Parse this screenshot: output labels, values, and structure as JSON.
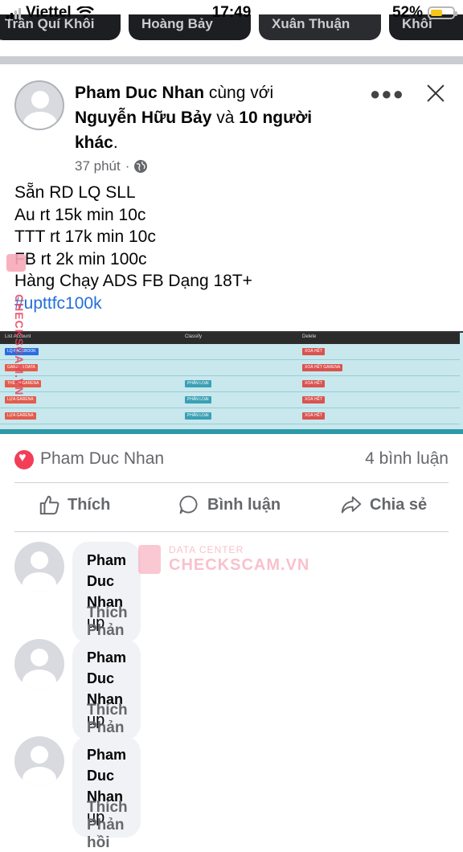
{
  "status_bar": {
    "carrier": "Viettel",
    "time": "17:49",
    "battery_percent": "52%",
    "battery_level": 0.52
  },
  "stories": [
    {
      "label": "Trần Quí Khôi"
    },
    {
      "label": "Hoàng Bảy"
    },
    {
      "label": "Xuân Thuận"
    },
    {
      "label": "Khôi"
    }
  ],
  "post": {
    "author": "Pham Duc Nhan",
    "with_text": "cùng với",
    "tagged_person": "Nguyễn Hữu Bảy",
    "and_text": "và",
    "others": "10 người khác",
    "end_dot": ".",
    "time": "37 phút",
    "dot": "·",
    "lines": [
      "Sẵn RD LQ SLL",
      "Au rt 15k min 10c",
      "TTT rt 17k min 10c",
      "FB rt 2k min 100c",
      "Hàng Chạy ADS FB Dạng 18T+"
    ],
    "hashtag": "#upttfc100k",
    "screenshot": {
      "headers": [
        "List Account",
        "Classify",
        "Delete"
      ],
      "rows": [
        {
          "account": "LQ FACEBOOK",
          "classify": "",
          "delete": "XOÁ HẾT"
        },
        {
          "account": "GARENA DATA",
          "classify": "",
          "delete": "XOÁ HẾT GARENA"
        },
        {
          "account": "THẺ 18 GARENA",
          "classify": "PHÂN LOẠI",
          "delete": "XOÁ HẾT"
        },
        {
          "account": "LỰA GARENA",
          "classify": "PHÂN LOẠI",
          "delete": "XOÁ HẾT"
        },
        {
          "account": "LỰA GARENA",
          "classify": "PHÂN LOẠI",
          "delete": "XOÁ HẾT"
        }
      ]
    }
  },
  "reactions": {
    "name": "Pham Duc Nhan",
    "comments_count": "4 bình luận"
  },
  "actions": {
    "like": "Thích",
    "comment": "Bình luận",
    "share": "Chia sẻ"
  },
  "comments": [
    {
      "author": "Pham Duc Nhan",
      "text": "up",
      "like": "Thích",
      "reply": "Phản hồi"
    },
    {
      "author": "Pham Duc Nhan",
      "text": "up",
      "like": "Thích",
      "reply": "Phản hồi"
    },
    {
      "author": "Pham Duc Nhan",
      "text": "up",
      "like": "Thích",
      "reply": "Phản hồi"
    }
  ],
  "watermark": {
    "line1": "DATA CENTER",
    "line2": "CHECKSCAM.VN",
    "vertical": "CHECKSCAM.VN"
  },
  "colors": {
    "link": "#216fdb",
    "muted": "#65676b",
    "heart": "#f33e58",
    "bubble": "#f0f2f5"
  }
}
